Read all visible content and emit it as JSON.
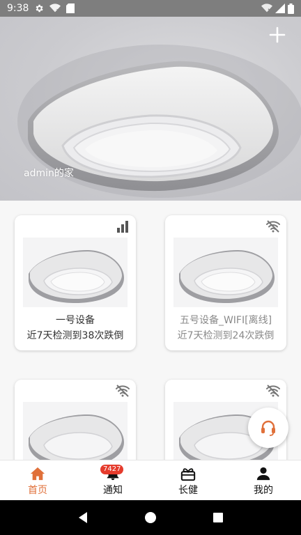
{
  "status_bar": {
    "time": "9:38",
    "left_icons": [
      "gear-icon",
      "wifi-question-icon",
      "sd-card-icon"
    ],
    "right_icons": [
      "wifi-off-icon",
      "cell-signal-icon",
      "battery-icon"
    ]
  },
  "hero": {
    "home_name": "admin的家",
    "add_icon": "plus-icon"
  },
  "devices": [
    {
      "name": "一号设备",
      "stat": "近7天检测到38次跌倒",
      "signal_icon": "signal-bars-icon",
      "online": true
    },
    {
      "name": "五号设备_WIFI[离线]",
      "stat": "近7天检测到24次跌倒",
      "signal_icon": "wifi-off-icon",
      "online": false
    },
    {
      "name": "",
      "stat": "",
      "signal_icon": "wifi-off-icon",
      "online": false
    },
    {
      "name": "",
      "stat": "",
      "signal_icon": "wifi-off-icon",
      "online": false
    }
  ],
  "support_fab": {
    "icon": "headset-icon"
  },
  "bottom_nav": {
    "items": [
      {
        "label": "首页",
        "icon": "home-icon",
        "active": true
      },
      {
        "label": "通知",
        "icon": "bell-icon",
        "badge": "7427"
      },
      {
        "label": "长健",
        "icon": "gift-box-icon"
      },
      {
        "label": "我的",
        "icon": "person-icon"
      }
    ]
  },
  "colors": {
    "accent": "#e0703a",
    "badge": "#e53b2c",
    "status_bar": "#7e7e7e"
  }
}
